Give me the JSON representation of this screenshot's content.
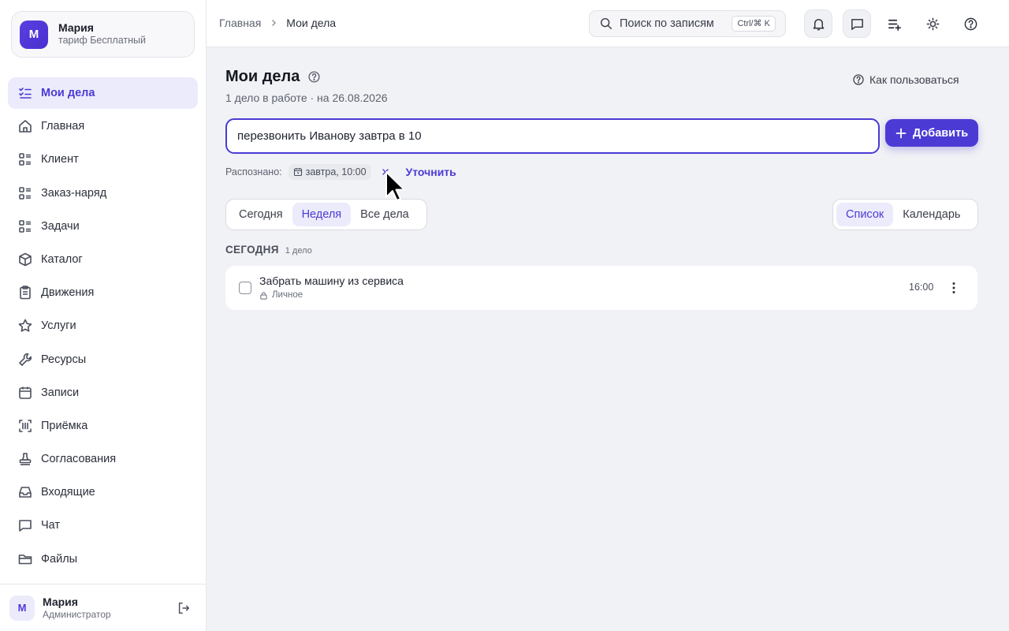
{
  "workspace": {
    "avatar_letter": "M",
    "name": "Мария",
    "plan": "тариф Бесплатный"
  },
  "sidebar": {
    "items": [
      {
        "label": "Мои дела",
        "icon": "checklist-icon",
        "active": true
      },
      {
        "label": "Главная",
        "icon": "home-icon"
      },
      {
        "label": "Клиент",
        "icon": "list-icon"
      },
      {
        "label": "Заказ-наряд",
        "icon": "list-icon"
      },
      {
        "label": "Задачи",
        "icon": "list-icon"
      },
      {
        "label": "Каталог",
        "icon": "box-icon"
      },
      {
        "label": "Движения",
        "icon": "clipboard-icon"
      },
      {
        "label": "Услуги",
        "icon": "star-icon"
      },
      {
        "label": "Ресурсы",
        "icon": "wrench-icon"
      },
      {
        "label": "Записи",
        "icon": "calendar-icon"
      },
      {
        "label": "Приёмка",
        "icon": "barcode-scan-icon"
      },
      {
        "label": "Согласования",
        "icon": "stamp-icon"
      },
      {
        "label": "Входящие",
        "icon": "inbox-icon"
      },
      {
        "label": "Чат",
        "icon": "chat-icon"
      },
      {
        "label": "Файлы",
        "icon": "folder-icon"
      }
    ]
  },
  "user": {
    "avatar_letter": "M",
    "name": "Мария",
    "role": "Администратор"
  },
  "topbar": {
    "breadcrumb": [
      "Главная",
      "Мои дела"
    ],
    "search_placeholder": "Поиск по записям",
    "search_shortcut": "Ctrl/⌘ K"
  },
  "page": {
    "title": "Мои дела",
    "subtitle": "1 дело в работе · на 26.08.2026",
    "how_to": "Как пользоваться",
    "input_value": "перезвонить Иванову завтра в 10",
    "add_label": "Добавить",
    "recognized_label": "Распознано:",
    "recognized_chip": "завтра, 10:00",
    "refine_label": "Уточнить",
    "range_tabs": [
      "Сегодня",
      "Неделя",
      "Все дела"
    ],
    "range_selected": "Неделя",
    "view_tabs": [
      "Список",
      "Календарь"
    ],
    "view_selected": "Список",
    "group": {
      "title": "СЕГОДНЯ",
      "count": "1 дело"
    },
    "tasks": [
      {
        "title": "Забрать машину из сервиса",
        "tag": "Личное",
        "time": "16:00"
      }
    ]
  },
  "colors": {
    "accent": "#4b3bd4",
    "accent_soft": "#ecebfb",
    "background": "#f1f2f5"
  }
}
